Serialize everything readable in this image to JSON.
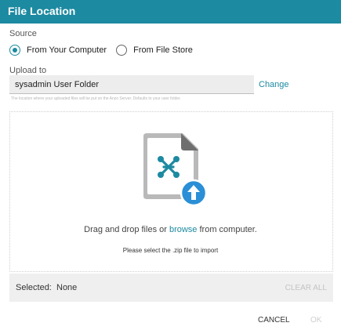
{
  "dialog": {
    "title": "File Location"
  },
  "source": {
    "label": "Source",
    "options": [
      {
        "label": "From Your Computer",
        "selected": true
      },
      {
        "label": "From File Store",
        "selected": false
      }
    ]
  },
  "upload": {
    "label": "Upload to",
    "value": "sysadmin User Folder",
    "change_label": "Change",
    "hint": "The location where your uploaded files will be put on the Anzo Server. Defaults to your user folder."
  },
  "dropzone": {
    "text_before": "Drag and drop files or ",
    "browse_label": "browse",
    "text_after": " from computer.",
    "note": "Please select the .zip file to import",
    "icon": "file-upload-icon"
  },
  "selection": {
    "label": "Selected:",
    "value": "None",
    "clear_label": "CLEAR ALL"
  },
  "actions": {
    "cancel_label": "CANCEL",
    "ok_label": "OK"
  },
  "colors": {
    "accent": "#1c8aa1",
    "header": "#1c8aa1",
    "upload_badge": "#2a8fd6"
  }
}
